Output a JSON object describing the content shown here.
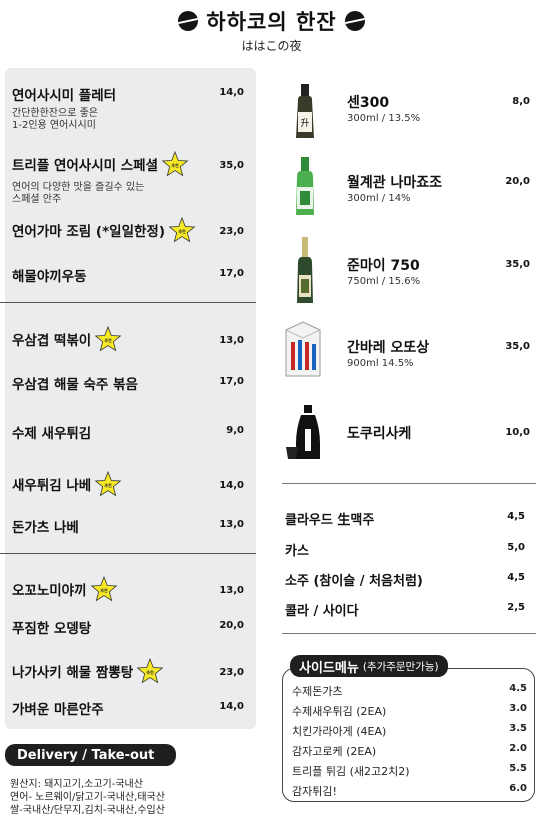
{
  "header": {
    "title": "하하코의 한잔",
    "subtitle": "ははこの夜"
  },
  "food": [
    {
      "name": "연어사시미 플레터",
      "price": "14,0",
      "desc": [
        "간단한한잔으로 좋은",
        "1-2인용 연어시시미"
      ],
      "star": false
    },
    {
      "name": "트리플 연어사시미 스페셜",
      "price": "35,0",
      "desc": [
        "연어의 다양한 맛을 즐길수 있는",
        "스페셜 안주"
      ],
      "star": true
    },
    {
      "name": "연어가마 조림 (*일일한정)",
      "price": "23,0",
      "desc": [],
      "star": true
    },
    {
      "name": "해물야끼우동",
      "price": "17,0",
      "desc": [],
      "star": false
    },
    {
      "name": "우삼겹 떡볶이",
      "price": "13,0",
      "desc": [],
      "star": true
    },
    {
      "name": "우삼겹 해물 숙주 볶음",
      "price": "17,0",
      "desc": [],
      "star": false
    },
    {
      "name": "수제 새우튀김",
      "price": "9,0",
      "desc": [],
      "star": false
    },
    {
      "name": "새우튀김 나베",
      "price": "14,0",
      "desc": [],
      "star": true
    },
    {
      "name": "돈가츠 나베",
      "price": "13,0",
      "desc": [],
      "star": false
    },
    {
      "name": "오꼬노미야끼",
      "price": "13,0",
      "desc": [],
      "star": true
    },
    {
      "name": "푸짐한 오뎅탕",
      "price": "20,0",
      "desc": [],
      "star": false
    },
    {
      "name": "나가사키 해물 짬뽕탕",
      "price": "23,0",
      "desc": [],
      "star": true
    },
    {
      "name": "가벼운 마른안주",
      "price": "14,0",
      "desc": [],
      "star": false
    }
  ],
  "drinks": [
    {
      "name": "센300",
      "sub": "300ml / 13.5%",
      "price": "8,0",
      "icon": "sake-bottle-icon"
    },
    {
      "name": "월계관 나마죠조",
      "sub": "300ml / 14%",
      "price": "20,0",
      "icon": "green-bottle-icon"
    },
    {
      "name": "준마이 750",
      "sub": "750ml / 15.6%",
      "price": "35,0",
      "icon": "tall-bottle-icon"
    },
    {
      "name": "간바레 오또상",
      "sub": "900ml 14.5%",
      "price": "35,0",
      "icon": "carton-icon"
    },
    {
      "name": "도쿠리사케",
      "sub": "",
      "price": "10,0",
      "icon": "tokkuri-icon"
    }
  ],
  "beverages": [
    {
      "name": "클라우드 生맥주",
      "price": "4,5"
    },
    {
      "name": "카스",
      "price": "5,0"
    },
    {
      "name": "소주 (참이슬 / 처음처럼)",
      "price": "4,5"
    },
    {
      "name": "콜라 / 사이다",
      "price": "2,5"
    }
  ],
  "side_menu": {
    "title": "사이드메뉴",
    "note": "(추가주문만가능)",
    "items": [
      {
        "name": "수제돈가츠",
        "price": "4.5"
      },
      {
        "name": "수제새우튀김 (2EA)",
        "price": "3.0"
      },
      {
        "name": "치킨가라아게 (4EA)",
        "price": "3.5"
      },
      {
        "name": "감자고로케 (2EA)",
        "price": "2.0"
      },
      {
        "name": "트리플 튀김 (새2고2치2)",
        "price": "5.5"
      },
      {
        "name": "감자튀김!",
        "price": "6.0"
      }
    ]
  },
  "delivery": {
    "title": "Delivery / Take-out",
    "origin": [
      "원산지: 돼지고기,소고기-국내산",
      "연어- 노르웨이/닭고기-국내산,태국산",
      "쌀-국내산/단무지,김치-국내산,수입산"
    ]
  },
  "star_label": "추천",
  "colors": {
    "panel": "#eaeced",
    "star": "#f7e926",
    "dark": "#1f1f1f"
  }
}
